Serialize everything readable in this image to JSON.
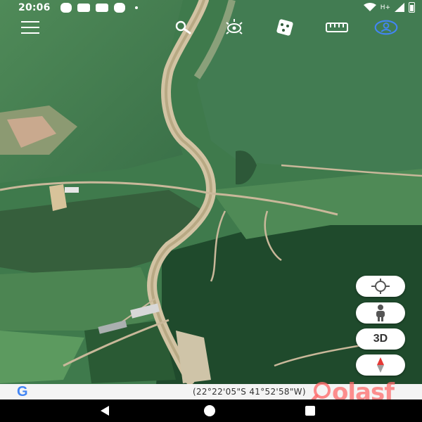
{
  "status_bar": {
    "time": "20:06",
    "notification_icons": [
      "whatsapp-icon",
      "youtube-icon",
      "youtube-icon",
      "instagram-icon",
      "dot-icon"
    ],
    "network": "H+",
    "status_icons": [
      "wifi-icon",
      "signal-icon",
      "battery-icon"
    ]
  },
  "toolbar": {
    "icons": [
      "menu-icon",
      "search-icon",
      "sunlight-icon",
      "random-dice-icon",
      "ruler-icon",
      "account-icon"
    ]
  },
  "controls": {
    "buttons": [
      "my-location-icon",
      "pegman-icon",
      "3d-toggle",
      "compass-icon"
    ],
    "three_d_label": "3D"
  },
  "attribution": {
    "logo": "G",
    "coordinates": "(22°22'05\"S 41°52'58\"W)"
  },
  "watermark": {
    "text": "olasf"
  },
  "nav_bar": {
    "buttons": [
      "back-icon",
      "home-icon",
      "recents-icon"
    ]
  },
  "colors": {
    "accent": "#4285f4",
    "forest": "#2f5a3a",
    "road": "#c9b89a",
    "watermark": "#ff6b6b"
  }
}
